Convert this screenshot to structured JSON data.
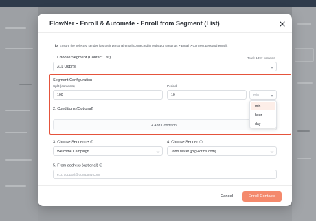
{
  "modal": {
    "title": "FlowNer - Enroll & Automate - Enroll from Segment (List)",
    "tip_label": "Tip:",
    "tip_text": "Ensure the selected sender has their personal email connected in HubSpot (Settings > Email > Connect personal email).",
    "segment": {
      "label": "1. Choose Segment (Contact List)",
      "total": "Total: 1497 contacts",
      "value": "ALL USERS"
    },
    "config": {
      "heading": "Segment Configuration",
      "split_label": "Split (contacts)",
      "split_value": "100",
      "period_label": "Period",
      "period_value": "10",
      "unit_placeholder": "min",
      "unit_options": [
        "min",
        "hour",
        "day"
      ],
      "unit_highlighted": "min"
    },
    "conditions": {
      "label": "2. Conditions (Optional)",
      "add_label": "+ Add Condition"
    },
    "sequence": {
      "label": "3. Choose Sequence",
      "value": "Welcome Campaign"
    },
    "sender": {
      "label": "4. Choose Sender",
      "value": "John Maret (jo@4crms.com)"
    },
    "from_address": {
      "label": "5. From address (optional)",
      "placeholder": "e.g. support@company.com"
    },
    "buttons": {
      "cancel": "Cancel",
      "enroll": "Enroll Contacts"
    }
  },
  "colors": {
    "accent": "#f4896c",
    "highlight_border": "#e5533c",
    "dropdown_hover": "#fdeee8"
  },
  "icons": [
    "close-icon",
    "chevron-down-icon",
    "info-icon"
  ]
}
